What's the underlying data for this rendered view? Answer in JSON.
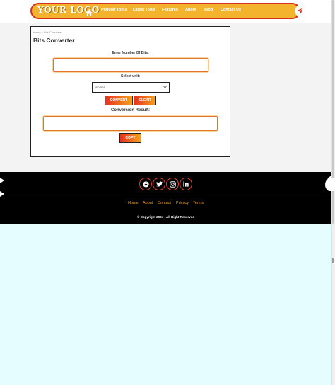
{
  "header": {
    "logo_text": "YOUR LOGO",
    "nav": {
      "home_icon": "home-icon",
      "items": [
        "Popular Tools",
        "Latest Tools",
        "Features",
        "About",
        "Blog",
        "Contact Us"
      ],
      "send_icon": "paper-plane-icon"
    }
  },
  "converter": {
    "breadcrumb": "Home  >  Bits Converter",
    "title": "Bits Converter",
    "input_label": "Enter Number Of Bits:",
    "input_value": "",
    "unit_label": "Select unit:",
    "unit_selected": "Nibbles",
    "convert_label": "CONVERT",
    "clear_label": "CLEAR",
    "result_label": "Conversion Result:",
    "result_value": "",
    "copy_label": "COPY"
  },
  "footer": {
    "social_icons": [
      "facebook-icon",
      "twitter-icon",
      "instagram-icon",
      "linkedin-icon"
    ],
    "links": [
      "Home",
      "About",
      "Contact",
      "Privacy",
      "Terms"
    ],
    "copyright": "© Copyright 2024 - All Right Reserved"
  },
  "colors": {
    "nav_background": "#f4b32d",
    "nav_border": "#d4311e",
    "button_gradient_start": "#e8311f",
    "button_gradient_end": "#f4a21c",
    "footer_background": "#000000",
    "footer_link": "#f4a21c",
    "page_background": "#e6fdff"
  }
}
